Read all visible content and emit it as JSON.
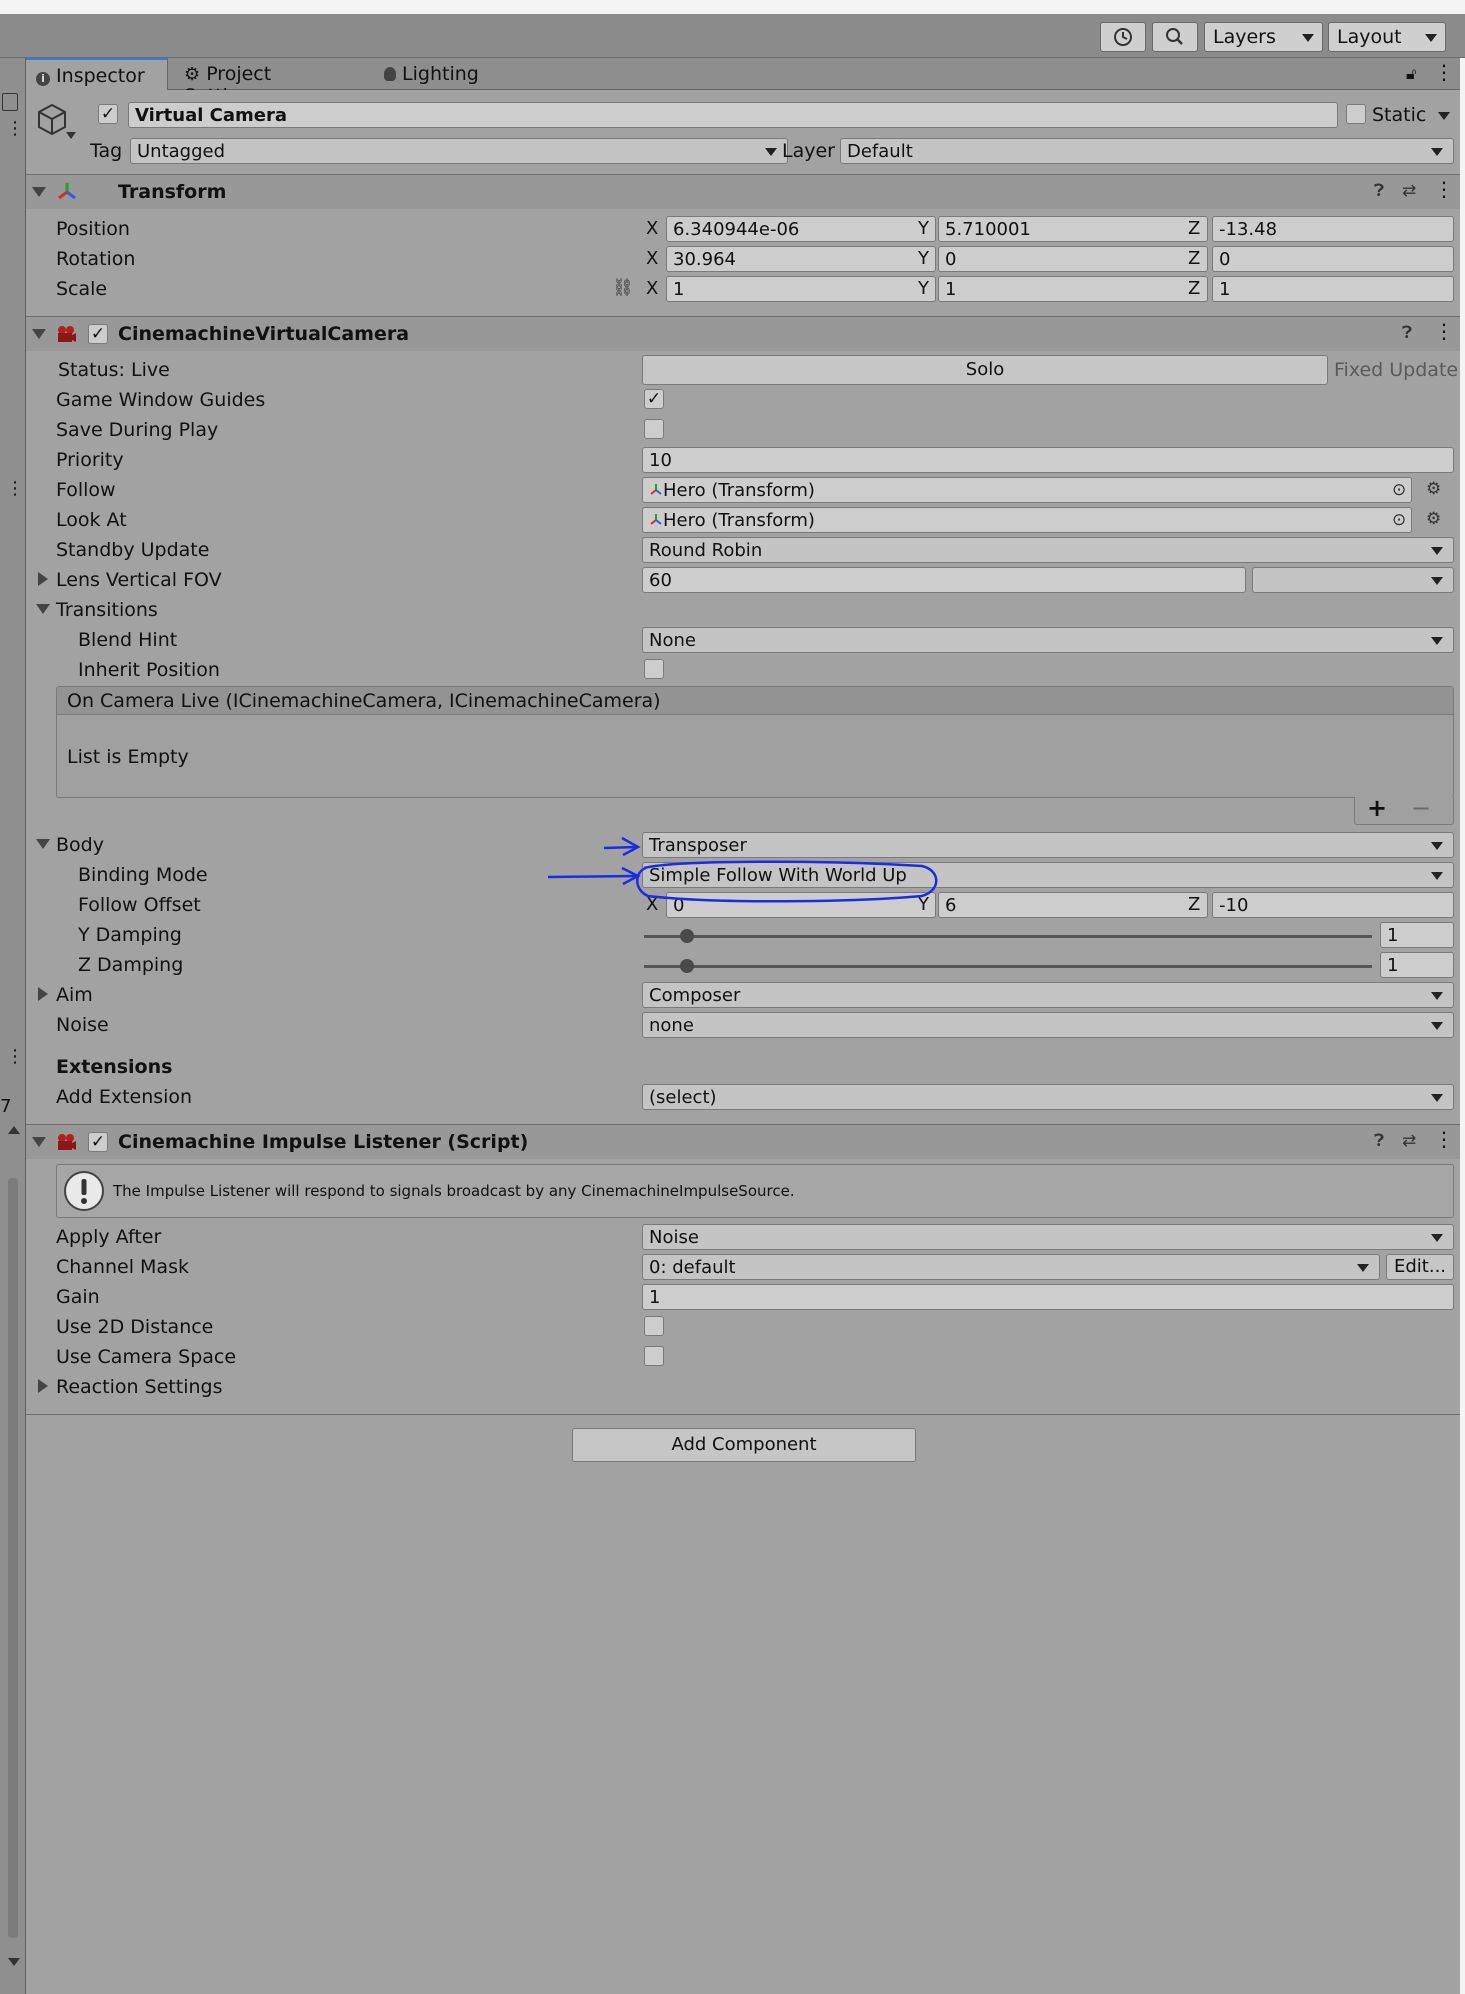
{
  "toolbar": {
    "history_icon": "history-icon",
    "search_icon": "search-icon",
    "layers_label": "Layers",
    "layout_label": "Layout"
  },
  "tabs": [
    {
      "label": "Inspector",
      "icon": "info-icon",
      "active": true
    },
    {
      "label": "Project Settings",
      "icon": "gear-icon",
      "active": false
    },
    {
      "label": "Lighting",
      "icon": "bulb-icon",
      "active": false
    }
  ],
  "object": {
    "name": "Virtual Camera",
    "active": true,
    "static_label": "Static",
    "tag_label": "Tag",
    "tag_value": "Untagged",
    "layer_label": "Layer",
    "layer_value": "Default"
  },
  "transform": {
    "title": "Transform",
    "rows": [
      {
        "label": "Position",
        "x": "6.340944e-06",
        "y": "5.710001",
        "z": "-13.48"
      },
      {
        "label": "Rotation",
        "x": "30.964",
        "y": "0",
        "z": "0"
      },
      {
        "label": "Scale",
        "x": "1",
        "y": "1",
        "z": "1"
      }
    ]
  },
  "axes": {
    "x": "X",
    "y": "Y",
    "z": "Z"
  },
  "vcam": {
    "title": "CinemachineVirtualCamera",
    "status_label": "Status: Live",
    "solo_label": "Solo",
    "fixed_update_label": "Fixed Update",
    "game_window_guides_label": "Game Window Guides",
    "game_window_guides": true,
    "save_during_play_label": "Save During Play",
    "save_during_play": false,
    "priority_label": "Priority",
    "priority_value": "10",
    "follow_label": "Follow",
    "follow_value": "Hero (Transform)",
    "look_at_label": "Look At",
    "look_at_value": "Hero (Transform)",
    "standby_label": "Standby Update",
    "standby_value": "Round Robin",
    "lens_label": "Lens Vertical FOV",
    "lens_value": "60",
    "transitions_label": "Transitions",
    "blend_hint_label": "Blend Hint",
    "blend_hint_value": "None",
    "inherit_position_label": "Inherit Position",
    "inherit_position": false,
    "event_header": "On Camera Live (ICinemachineCamera, ICinemachineCamera)",
    "event_empty": "List is Empty",
    "add_glyph": "+",
    "remove_glyph": "−",
    "body_label": "Body",
    "body_value": "Transposer",
    "binding_mode_label": "Binding Mode",
    "binding_mode_value": "Simple Follow With World Up",
    "follow_offset_label": "Follow Offset",
    "follow_offset": {
      "x": "0",
      "y": "6",
      "z": "-10"
    },
    "y_damping_label": "Y Damping",
    "y_damping_value": "1",
    "z_damping_label": "Z Damping",
    "z_damping_value": "1",
    "aim_label": "Aim",
    "aim_value": "Composer",
    "noise_label": "Noise",
    "noise_value": "none",
    "extensions_label": "Extensions",
    "add_extension_label": "Add Extension",
    "add_extension_value": "(select)"
  },
  "impulse": {
    "title": "Cinemachine Impulse Listener (Script)",
    "info_text": "The Impulse Listener will respond to signals broadcast by any CinemachineImpulseSource.",
    "apply_after_label": "Apply After",
    "apply_after_value": "Noise",
    "channel_mask_label": "Channel Mask",
    "channel_mask_value": "0: default",
    "edit_label": "Edit...",
    "gain_label": "Gain",
    "gain_value": "1",
    "use_2d_label": "Use 2D Distance",
    "use_camera_space_label": "Use Camera Space",
    "reaction_label": "Reaction Settings"
  },
  "add_component_label": "Add Component",
  "side_text": "7",
  "colors": {
    "accent": "#3a79d8",
    "annotation": "#1a2de0"
  }
}
